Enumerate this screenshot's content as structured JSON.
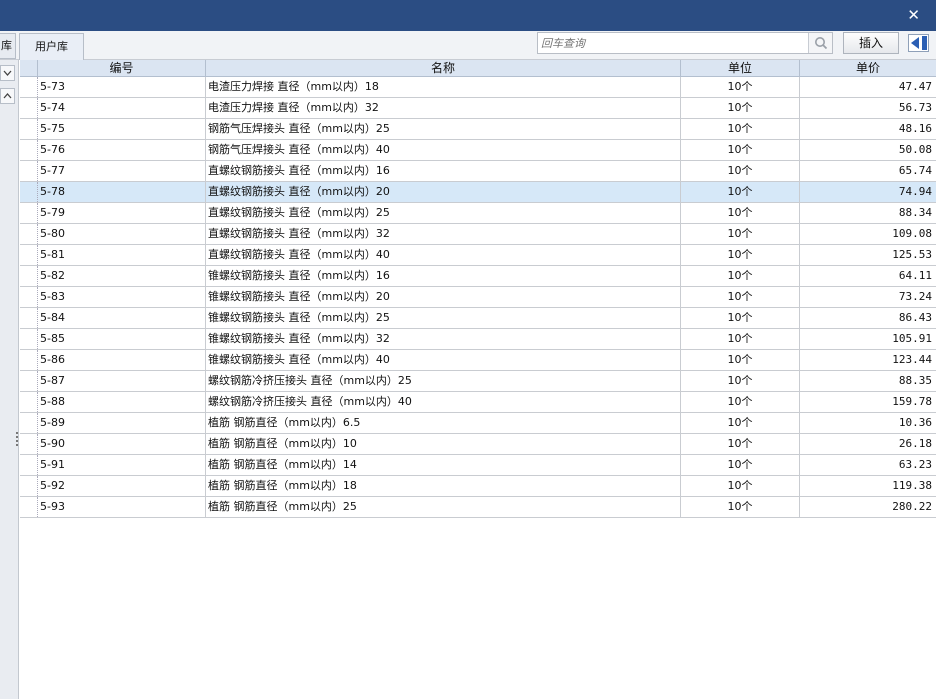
{
  "titlebar": {
    "close_glyph": "✕"
  },
  "toolbar": {
    "left_tab_stub": "库",
    "user_tab": "用户库",
    "search_placeholder": "回车查询",
    "insert_label": "插入"
  },
  "icons": {
    "search": "search-icon",
    "collapse": "collapse-panel-icon",
    "dropdown": "chevron-down-icon",
    "up": "chevron-up-icon"
  },
  "colors": {
    "titlebar": "#2b4d83",
    "header": "#dbe5f2",
    "selected_row": "#d6e8f8",
    "accent": "#2b5fb4"
  },
  "table": {
    "columns": {
      "code": "编号",
      "name": "名称",
      "unit": "单位",
      "price": "单价"
    },
    "selected_index": 5,
    "rows": [
      {
        "code": "5-73",
        "name": "电渣压力焊接 直径（mm以内）18",
        "unit": "10个",
        "price": "47.47"
      },
      {
        "code": "5-74",
        "name": "电渣压力焊接 直径（mm以内）32",
        "unit": "10个",
        "price": "56.73"
      },
      {
        "code": "5-75",
        "name": "钢筋气压焊接头 直径（mm以内）25",
        "unit": "10个",
        "price": "48.16"
      },
      {
        "code": "5-76",
        "name": "钢筋气压焊接头 直径（mm以内）40",
        "unit": "10个",
        "price": "50.08"
      },
      {
        "code": "5-77",
        "name": "直螺纹钢筋接头 直径（mm以内）16",
        "unit": "10个",
        "price": "65.74"
      },
      {
        "code": "5-78",
        "name": "直螺纹钢筋接头 直径（mm以内）20",
        "unit": "10个",
        "price": "74.94"
      },
      {
        "code": "5-79",
        "name": "直螺纹钢筋接头 直径（mm以内）25",
        "unit": "10个",
        "price": "88.34"
      },
      {
        "code": "5-80",
        "name": "直螺纹钢筋接头 直径（mm以内）32",
        "unit": "10个",
        "price": "109.08"
      },
      {
        "code": "5-81",
        "name": "直螺纹钢筋接头 直径（mm以内）40",
        "unit": "10个",
        "price": "125.53"
      },
      {
        "code": "5-82",
        "name": "锥螺纹钢筋接头 直径（mm以内）16",
        "unit": "10个",
        "price": "64.11"
      },
      {
        "code": "5-83",
        "name": "锥螺纹钢筋接头 直径（mm以内）20",
        "unit": "10个",
        "price": "73.24"
      },
      {
        "code": "5-84",
        "name": "锥螺纹钢筋接头 直径（mm以内）25",
        "unit": "10个",
        "price": "86.43"
      },
      {
        "code": "5-85",
        "name": "锥螺纹钢筋接头 直径（mm以内）32",
        "unit": "10个",
        "price": "105.91"
      },
      {
        "code": "5-86",
        "name": "锥螺纹钢筋接头 直径（mm以内）40",
        "unit": "10个",
        "price": "123.44"
      },
      {
        "code": "5-87",
        "name": "螺纹钢筋冷挤压接头 直径（mm以内）25",
        "unit": "10个",
        "price": "88.35"
      },
      {
        "code": "5-88",
        "name": "螺纹钢筋冷挤压接头 直径（mm以内）40",
        "unit": "10个",
        "price": "159.78"
      },
      {
        "code": "5-89",
        "name": "植筋 钢筋直径（mm以内）6.5",
        "unit": "10个",
        "price": "10.36"
      },
      {
        "code": "5-90",
        "name": "植筋 钢筋直径（mm以内）10",
        "unit": "10个",
        "price": "26.18"
      },
      {
        "code": "5-91",
        "name": "植筋 钢筋直径（mm以内）14",
        "unit": "10个",
        "price": "63.23"
      },
      {
        "code": "5-92",
        "name": "植筋 钢筋直径（mm以内）18",
        "unit": "10个",
        "price": "119.38"
      },
      {
        "code": "5-93",
        "name": "植筋 钢筋直径（mm以内）25",
        "unit": "10个",
        "price": "280.22"
      }
    ]
  }
}
